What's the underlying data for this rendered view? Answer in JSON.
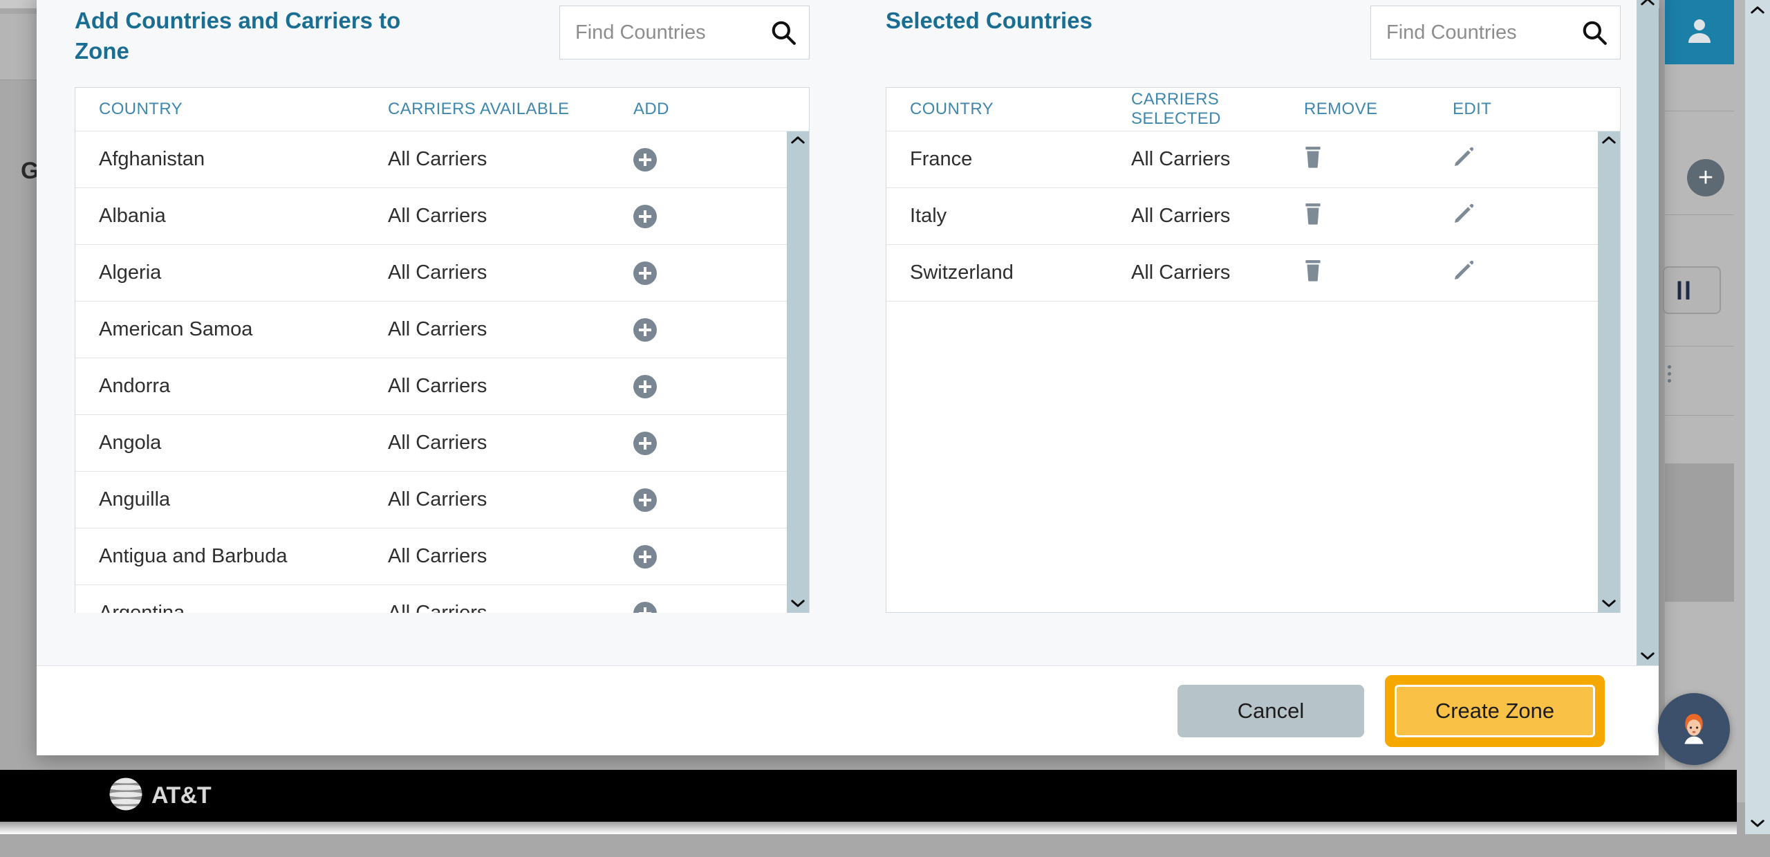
{
  "colors": {
    "accent_blue": "#1a6d93",
    "header_label_blue": "#3f87ad",
    "primary_yellow": "#f9c146",
    "focus_ring_yellow": "#f5a800",
    "cancel_gray": "#b6c4ca",
    "scrollbar": "#b9cbd3",
    "footer_black": "#000000",
    "chat_navy": "#3c4f6b"
  },
  "modal": {
    "left_pane": {
      "title": "Add Countries and Carriers to Zone",
      "search": {
        "placeholder": "Find Countries",
        "value": "",
        "icon": "search-icon"
      },
      "columns": [
        "COUNTRY",
        "CARRIERS AVAILABLE",
        "ADD"
      ],
      "rows": [
        {
          "country": "Afghanistan",
          "carriers": "All Carriers",
          "add_icon": "plus-circle-icon"
        },
        {
          "country": "Albania",
          "carriers": "All Carriers",
          "add_icon": "plus-circle-icon"
        },
        {
          "country": "Algeria",
          "carriers": "All Carriers",
          "add_icon": "plus-circle-icon"
        },
        {
          "country": "American Samoa",
          "carriers": "All Carriers",
          "add_icon": "plus-circle-icon"
        },
        {
          "country": "Andorra",
          "carriers": "All Carriers",
          "add_icon": "plus-circle-icon"
        },
        {
          "country": "Angola",
          "carriers": "All Carriers",
          "add_icon": "plus-circle-icon"
        },
        {
          "country": "Anguilla",
          "carriers": "All Carriers",
          "add_icon": "plus-circle-icon"
        },
        {
          "country": "Antigua and Barbuda",
          "carriers": "All Carriers",
          "add_icon": "plus-circle-icon"
        },
        {
          "country": "Argentina",
          "carriers": "All Carriers",
          "add_icon": "plus-circle-icon"
        }
      ]
    },
    "right_pane": {
      "title": "Selected Countries",
      "search": {
        "placeholder": "Find Countries",
        "value": "",
        "icon": "search-icon"
      },
      "columns": [
        "COUNTRY",
        "CARRIERS SELECTED",
        "REMOVE",
        "EDIT"
      ],
      "rows": [
        {
          "country": "France",
          "carriers": "All Carriers",
          "remove_icon": "trash-icon",
          "edit_icon": "pencil-icon"
        },
        {
          "country": "Italy",
          "carriers": "All Carriers",
          "remove_icon": "trash-icon",
          "edit_icon": "pencil-icon"
        },
        {
          "country": "Switzerland",
          "carriers": "All Carriers",
          "remove_icon": "trash-icon",
          "edit_icon": "pencil-icon"
        }
      ]
    },
    "footer": {
      "cancel_label": "Cancel",
      "create_label": "Create Zone"
    }
  },
  "background": {
    "heading_partial": "G",
    "avatar_icon": "user-avatar-icon",
    "add_icon": "plus-circle-icon",
    "pause_glyph": "ll"
  },
  "page_footer": {
    "brand": "AT&T",
    "logo_icon": "att-globe-icon"
  },
  "chat": {
    "icon": "support-agent-avatar-icon"
  }
}
